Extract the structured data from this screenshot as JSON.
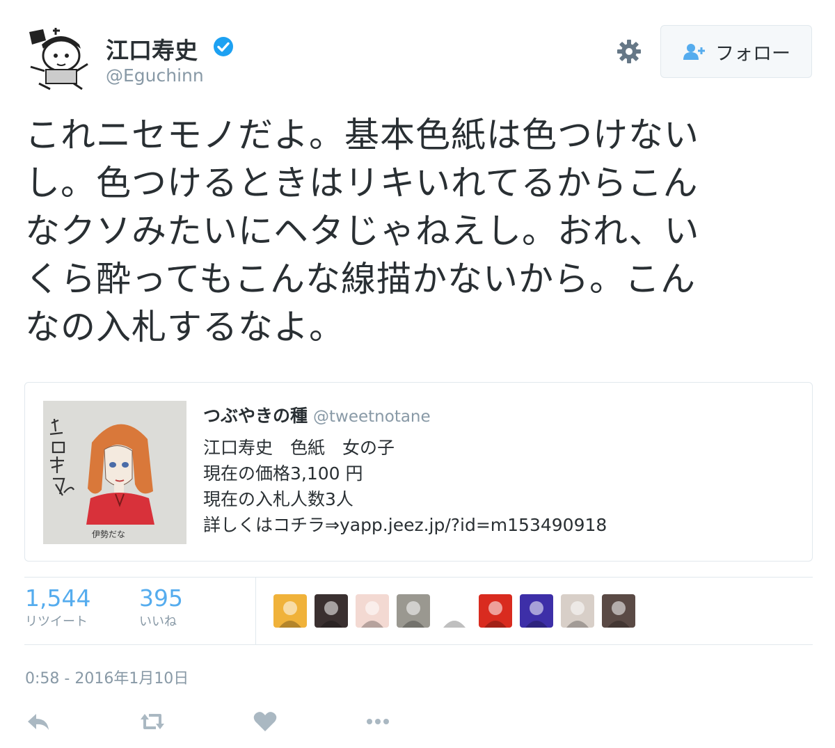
{
  "user": {
    "name": "江口寿史",
    "handle": "@Eguchinn",
    "verified": true,
    "avatar_icon": "manga-avatar-icon"
  },
  "header": {
    "follow_label": "フォロー",
    "settings_icon": "gear-icon"
  },
  "tweet": {
    "lines": [
      "これニセモノだよ。基本色紙は色つけない",
      "し。色つけるときはリキいれてるからこん",
      "なクソみたいにヘタじゃねえし。おれ、い",
      "くら酔ってもこんな線描かないから。こん",
      "なの入札するなよ。"
    ]
  },
  "quoted": {
    "author_name": "つぶやきの種",
    "author_handle": "@tweetnotane",
    "image_caption": "伊勢だな",
    "image_signature": "江口寿史",
    "lines": [
      "江口寿史　色紙　女の子",
      "現在の価格3,100 円",
      "現在の入札人数3人",
      "詳しくはコチラ⇒yapp.jeez.jp/?id=m153490918"
    ]
  },
  "stats": {
    "retweets_count": "1,544",
    "retweets_label": "リツイート",
    "likes_count": "395",
    "likes_label": "いいね"
  },
  "likers": [
    {
      "icon": "liker-avatar-1",
      "color": "#f0b23a"
    },
    {
      "icon": "liker-avatar-2",
      "color": "#3a3030"
    },
    {
      "icon": "liker-avatar-3",
      "color": "#f3d9d2"
    },
    {
      "icon": "liker-avatar-4",
      "color": "#9a9890"
    },
    {
      "icon": "liker-avatar-5",
      "color": "#ffffff"
    },
    {
      "icon": "liker-avatar-6",
      "color": "#d92b1f"
    },
    {
      "icon": "liker-avatar-7",
      "color": "#3d2fa8"
    },
    {
      "icon": "liker-avatar-8",
      "color": "#d8cfc8"
    },
    {
      "icon": "liker-avatar-9",
      "color": "#5a4a45"
    }
  ],
  "timestamp": "0:58 - 2016年1月10日",
  "actions": [
    "reply-icon",
    "retweet-icon",
    "like-icon",
    "more-icon"
  ],
  "colors": {
    "accent": "#55acee",
    "verified": "#1da1f2",
    "muted": "#8899a6",
    "border": "#e1e8ed",
    "text": "#292f33"
  }
}
